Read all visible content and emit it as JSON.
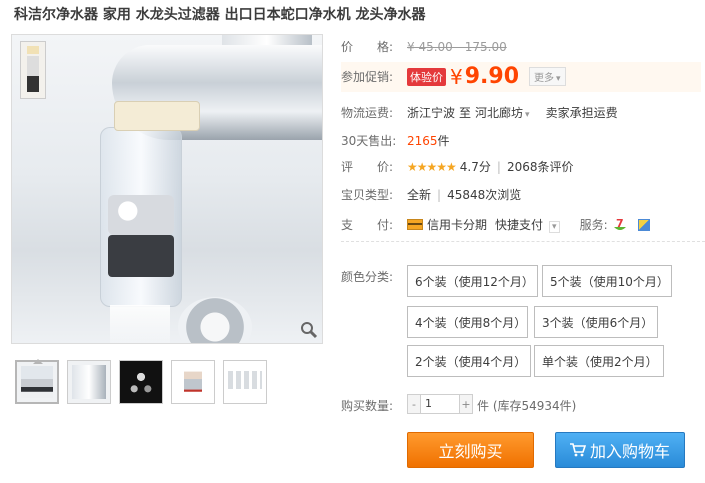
{
  "title": "科洁尔净水器 家用 水龙头过滤器 出口日本蛇口净水机 龙头净水器",
  "price_row": {
    "label": "价　　格:",
    "original": "¥ 45.00 - 175.00"
  },
  "promo_row": {
    "label": "参加促销:",
    "tag": "体验价",
    "currency": "¥",
    "price": "9.90",
    "more": "更多",
    "more_arrow": "▾"
  },
  "shipping_row": {
    "label": "物流运费:",
    "from": "浙江宁波",
    "to_word": "至",
    "to": "河北廊坊",
    "to_arrow": "▾",
    "fee": "卖家承担运费"
  },
  "sold_row": {
    "label": "30天售出:",
    "count": "2165",
    "unit": "件"
  },
  "rating_row": {
    "label": "评　　价:",
    "stars": "★★★★★",
    "score": "4.7分",
    "reviews": "2068条评价"
  },
  "condition_row": {
    "label": "宝贝类型:",
    "condition": "全新",
    "views": "45848次浏览"
  },
  "payment_row": {
    "label": "支　　付:",
    "card": "信用卡分期",
    "quick": "快捷支付",
    "quick_arrow": "▾",
    "service": "服务:"
  },
  "color_label": "颜色分类:",
  "options": [
    "6个装（使用12个月）",
    "5个装（使用10个月）",
    "4个装（使用8个月）",
    "3个装（使用6个月）",
    "2个装（使用4个月）",
    "单个装（使用2个月）"
  ],
  "qty": {
    "label": "购买数量:",
    "minus": "-",
    "value": "1",
    "plus": "+",
    "stock": "件 (库存54934件)"
  },
  "buttons": {
    "buy_now": "立刻购买",
    "add_cart": "加入购物车"
  }
}
